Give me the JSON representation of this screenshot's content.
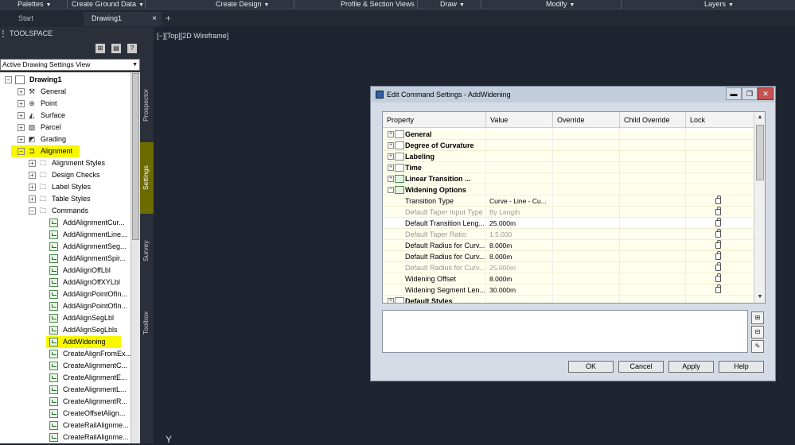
{
  "menubar": {
    "items": [
      "Palettes",
      "Create Ground Data",
      "Create Design",
      "Profile & Section Views",
      "Draw",
      "Modify",
      "Layers"
    ]
  },
  "tabs": {
    "start": "Start",
    "drawing": "Drawing1",
    "close": "×",
    "add": "+"
  },
  "toolspace": {
    "title": "TOOLSPACE",
    "view_select": "Active Drawing Settings View",
    "vertical_tabs": [
      "Prospector",
      "Settings",
      "Survey",
      "Toolbox"
    ],
    "tree": {
      "root": "Drawing1",
      "top_items": [
        "General",
        "Point",
        "Surface",
        "Parcel",
        "Grading",
        "Alignment"
      ],
      "alignment_children": [
        "Alignment Styles",
        "Design Checks",
        "Label Styles",
        "Table Styles",
        "Commands"
      ],
      "commands": [
        "AddAlignmentCur...",
        "AddAlignmentLine...",
        "AddAlignmentSeg...",
        "AddAlignmentSpir...",
        "AddAlignOffLbl",
        "AddAlignOffXYLbl",
        "AddAlignPointOfIn...",
        "AddAlignPointOfIn...",
        "AddAlignSegLbl",
        "AddAlignSegLbls",
        "AddWidening",
        "CreateAlignFromEx...",
        "CreateAlignmentC...",
        "CreateAlignmentE...",
        "CreateAlignmentL...",
        "CreateAlignmentR...",
        "CreateOffsetAlign...",
        "CreateRailAlignme...",
        "CreateRailAlignme..."
      ]
    }
  },
  "viewport": {
    "label": "[−][Top][2D Wireframe]"
  },
  "dialog": {
    "title": "Edit Command Settings - AddWidening",
    "window_buttons": [
      "▬",
      "❐",
      "✕"
    ],
    "columns": [
      "Property",
      "Value",
      "Override",
      "Child Override",
      "Lock"
    ],
    "categories": [
      "General",
      "Degree of Curvature",
      "Labeling",
      "Time",
      "Linear Transition ...",
      "Widening Options"
    ],
    "rows": [
      {
        "property": "Transition Type",
        "value": "Curve - Line - Cu..."
      },
      {
        "property": "Default Taper Input Type",
        "value": "By Length"
      },
      {
        "property": "Default Transition Leng...",
        "value": "25.000m"
      },
      {
        "property": "Default Taper Ratio",
        "value": "1:5.000"
      },
      {
        "property": "Default Radius for Curv...",
        "value": "8.000m"
      },
      {
        "property": "Default Radius for Curv...",
        "value": "8.000m"
      },
      {
        "property": "Default Radius for Curv...",
        "value": "25.000m"
      },
      {
        "property": "Widening Offset",
        "value": "8.000m"
      },
      {
        "property": "Widening Segment Len...",
        "value": "30.000m"
      }
    ],
    "last_category": "Default Styles",
    "buttons": {
      "ok": "OK",
      "cancel": "Cancel",
      "apply": "Apply",
      "help": "Help"
    }
  }
}
